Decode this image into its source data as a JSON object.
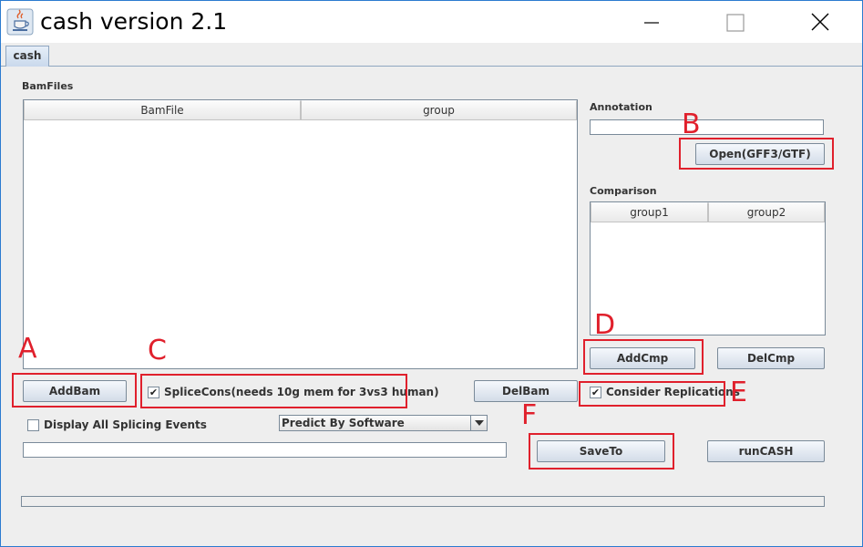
{
  "window": {
    "title": "cash version 2.1",
    "controls": {
      "minimize": "minimize-icon",
      "maximize": "maximize-icon",
      "close": "close-icon"
    }
  },
  "tabs": [
    {
      "label": "cash",
      "selected": true
    }
  ],
  "bam_files": {
    "label": "BamFiles",
    "columns": [
      "BamFile",
      "group"
    ],
    "rows": []
  },
  "annotation": {
    "label": "Annotation",
    "value": "",
    "open_button": "Open(GFF3/GTF)"
  },
  "comparison": {
    "label": "Comparison",
    "columns": [
      "group1",
      "group2"
    ],
    "rows": [],
    "add_button": "AddCmp",
    "del_button": "DelCmp"
  },
  "controls": {
    "add_bam": "AddBam",
    "del_bam": "DelBam",
    "splice_cons": {
      "label": "SpliceCons(needs 10g mem for 3vs3 human)",
      "checked": true
    },
    "consider_replications": {
      "label": "Consider Replications",
      "checked": true
    },
    "display_all": {
      "label": "Display All Splicing Events",
      "checked": false
    },
    "predict_select": {
      "value": "Predict By Software"
    },
    "output_path": "",
    "save_to": "SaveTo",
    "run_cash": "runCASH"
  },
  "progress": {
    "value": 0
  },
  "annotations": {
    "A": "A",
    "B": "B",
    "C": "C",
    "D": "D",
    "E": "E",
    "F": "F",
    "color": "#e0202c"
  },
  "colors": {
    "window_border": "#2b7bd0",
    "background": "#eeeeee"
  }
}
